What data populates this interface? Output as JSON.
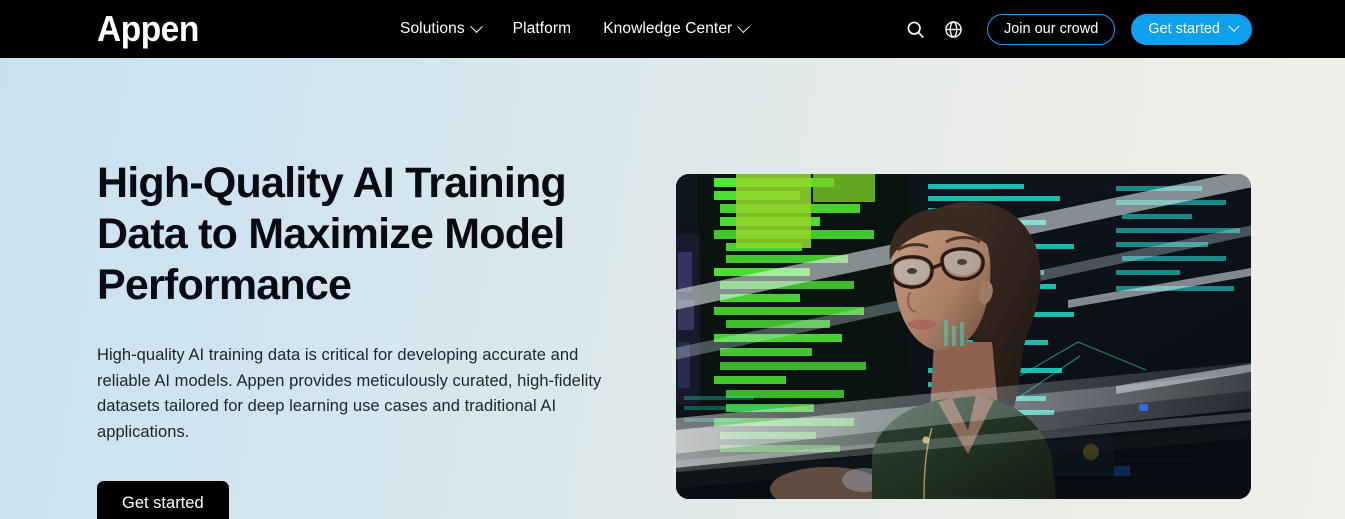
{
  "header": {
    "logo_text": "Appen",
    "nav": [
      {
        "label": "Solutions",
        "has_dropdown": true
      },
      {
        "label": "Platform",
        "has_dropdown": false
      },
      {
        "label": "Knowledge Center",
        "has_dropdown": true
      }
    ],
    "search_icon": "search-icon",
    "globe_icon": "globe-icon",
    "join_label": "Join our crowd",
    "get_started_label": "Get started",
    "accent_blue": "#10a0f0",
    "bar_background": "#000000"
  },
  "hero": {
    "headline": "High-Quality AI Training Data to Maximize Model Performance",
    "body": "High-quality AI training data is critical for developing accurate and reliable AI models. Appen provides meticulously curated, high-fidelity datasets tailored for deep learning use cases and traditional AI applications.",
    "cta_label": "Get started",
    "background_left_color": "#c9e1ef",
    "background_right_color": "#f1efea",
    "image_alt": "Woman wearing glasses in a dark room looking up at monitors displaying green and cyan code"
  }
}
